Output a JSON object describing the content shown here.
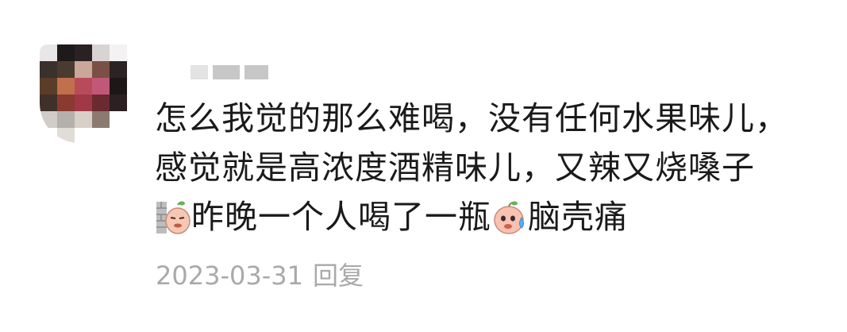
{
  "comment": {
    "lines": [
      "怎么我觉的那么难喝，没有任何水果味儿，",
      "感觉就是高浓度酒精味儿，又辣又烧嗓子",
      "昨晚一个人喝了一瓶"
    ],
    "line3_tail": "脑壳痛",
    "emojis": [
      "wall-lean-emoji",
      "sweat-emoji"
    ]
  },
  "meta": {
    "date": "2023-03-31",
    "reply_label": "回复"
  }
}
